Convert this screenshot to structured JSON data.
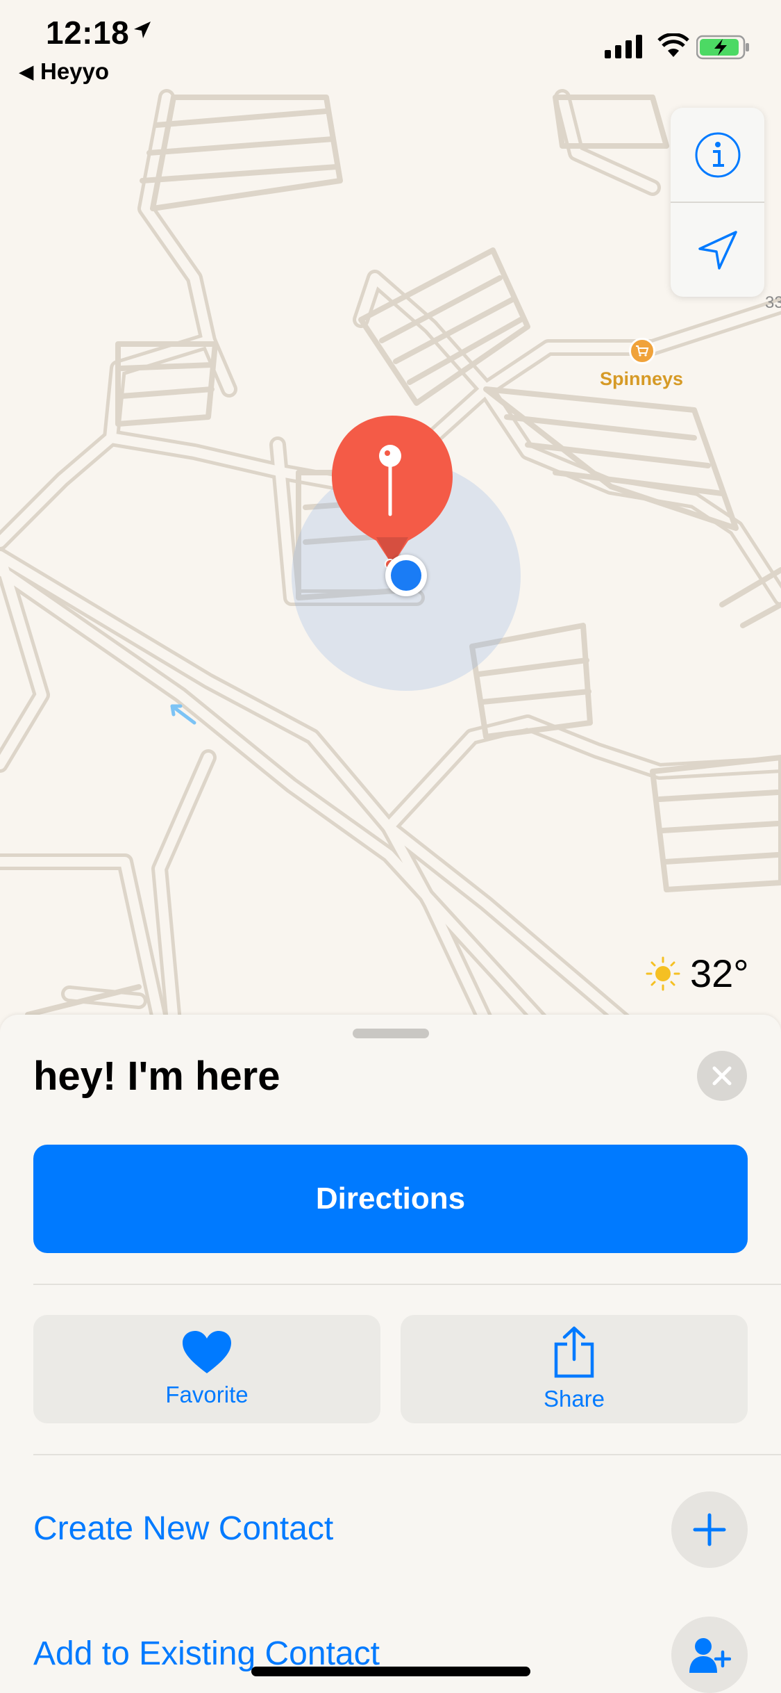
{
  "status_bar": {
    "time": "12:18",
    "back_label": "Heyyo"
  },
  "map": {
    "poi": {
      "name": "Spinneys",
      "icon": "shopping-cart-icon",
      "color": "#d69a26"
    },
    "edge_label": "33",
    "weather": {
      "icon": "sun-icon",
      "temperature": "32°"
    },
    "controls": [
      {
        "icon": "info-icon"
      },
      {
        "icon": "location-arrow-icon"
      }
    ]
  },
  "sheet": {
    "title": "hey! I'm here",
    "directions_label": "Directions",
    "actions": [
      {
        "label": "Favorite",
        "icon": "heart-icon"
      },
      {
        "label": "Share",
        "icon": "share-icon"
      }
    ],
    "create_contact_label": "Create New Contact",
    "add_existing_label": "Add to Existing Contact"
  },
  "colors": {
    "accent": "#007aff",
    "pin": "#f45b47",
    "user_location": "#1a7cf5"
  }
}
